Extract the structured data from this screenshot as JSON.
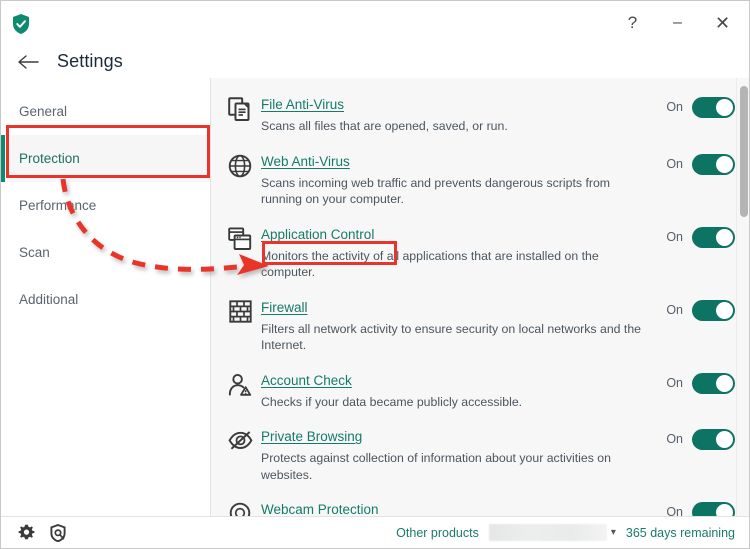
{
  "window": {
    "logo_icon": "shield-check-icon",
    "controls": [
      {
        "name": "help-button",
        "glyph": "?"
      },
      {
        "name": "minimize-button",
        "glyph": "–"
      },
      {
        "name": "close-button",
        "glyph": "✕"
      }
    ]
  },
  "header": {
    "back_icon": "arrow-left-icon",
    "title": "Settings"
  },
  "sidebar": {
    "items": [
      {
        "label": "General",
        "active": false
      },
      {
        "label": "Protection",
        "active": true
      },
      {
        "label": "Performance",
        "active": false
      },
      {
        "label": "Scan",
        "active": false
      },
      {
        "label": "Additional",
        "active": false
      }
    ]
  },
  "main": {
    "rows": [
      {
        "icon": "files-document-icon",
        "title": "File Anti-Virus",
        "desc": "Scans all files that are opened, saved, or run.",
        "state_label": "On",
        "state_on": true
      },
      {
        "icon": "globe-icon",
        "title": "Web Anti-Virus",
        "desc": "Scans incoming web traffic and prevents dangerous scripts from running on your computer.",
        "state_label": "On",
        "state_on": true
      },
      {
        "icon": "windows-stack-icon",
        "title": "Application Control",
        "desc": "Monitors the activity of all applications that are installed on the computer.",
        "state_label": "On",
        "state_on": true
      },
      {
        "icon": "brick-wall-icon",
        "title": "Firewall",
        "desc": "Filters all network activity to ensure security on local networks and the Internet.",
        "state_label": "On",
        "state_on": true
      },
      {
        "icon": "person-alert-icon",
        "title": "Account Check",
        "desc": "Checks if your data became publicly accessible.",
        "state_label": "On",
        "state_on": true
      },
      {
        "icon": "eye-slash-icon",
        "title": "Private Browsing",
        "desc": "Protects against collection of information about your activities on websites.",
        "state_label": "On",
        "state_on": true
      },
      {
        "icon": "webcam-icon",
        "title": "Webcam Protection",
        "desc": "",
        "state_label": "On",
        "state_on": true
      }
    ]
  },
  "statusbar": {
    "gear_icon": "gear-icon",
    "support_icon": "support-shield-icon",
    "other_products": "Other products",
    "dropdown_value": "",
    "chevron_icon": "chevron-down-icon",
    "license": "365 days remaining"
  },
  "annotations": {
    "highlight_color": "#e8342a",
    "boxes": [
      "Protection",
      "Application Control"
    ],
    "arrow": "dashed-curved-arrow"
  },
  "theme": {
    "accent": "#0d7363",
    "link": "#157a6a",
    "panel_bg": "#f7f7f7"
  }
}
